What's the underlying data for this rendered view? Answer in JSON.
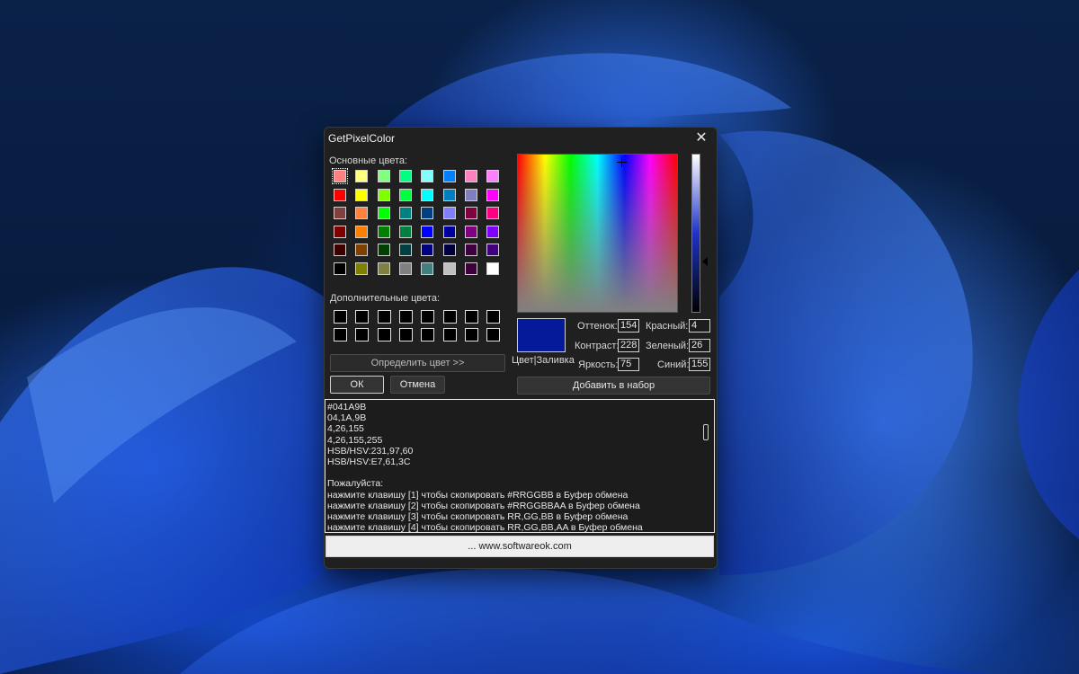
{
  "window": {
    "title": "GetPixelColor",
    "close_glyph": "✕"
  },
  "basic_colors": {
    "label": "Основные цвета:",
    "swatches": [
      "#ff8080",
      "#ffff80",
      "#80ff80",
      "#00ff80",
      "#80ffff",
      "#0080ff",
      "#ff80c0",
      "#ff80ff",
      "#ff0000",
      "#ffff00",
      "#80ff00",
      "#00ff40",
      "#00ffff",
      "#0080c0",
      "#8080c0",
      "#ff00ff",
      "#804040",
      "#ff8040",
      "#00ff00",
      "#008080",
      "#004080",
      "#8080ff",
      "#800040",
      "#ff0080",
      "#800000",
      "#ff8000",
      "#008000",
      "#008040",
      "#0000ff",
      "#0000a0",
      "#800080",
      "#8000ff",
      "#400000",
      "#804000",
      "#004000",
      "#004040",
      "#000080",
      "#000040",
      "#400040",
      "#400080",
      "#000000",
      "#808000",
      "#808040",
      "#808080",
      "#408080",
      "#c0c0c0",
      "#400040",
      "#ffffff"
    ]
  },
  "custom_colors": {
    "label": "Дополнительные цвета:",
    "count": 16,
    "color": "#000000"
  },
  "buttons": {
    "define": "Определить цвет >>",
    "ok": "ОК",
    "cancel": "Отмена",
    "add": "Добавить в набор"
  },
  "preview": {
    "color": "#041A9B",
    "label": "Цвет|Заливка"
  },
  "fields": {
    "hue_label": "Оттенок:",
    "hue": "154",
    "sat_label": "Контраст:",
    "sat": "228",
    "lum_label": "Яркость:",
    "lum": "75",
    "red_label": "Красный:",
    "red": "4",
    "green_label": "Зеленый:",
    "green": "26",
    "blue_label": "Синий:",
    "blue": "155"
  },
  "output_lines": [
    "#041A9B",
    "04,1A,9B",
    "4,26,155",
    "4,26,155,255",
    "HSB/HSV:231,97,60",
    "HSB/HSV:E7,61,3C",
    "",
    "Пожалуйста:",
    "нажмите клавишу [1] чтобы скопировать #RRGGBB в Буфер обмена",
    "нажмите клавишу [2] чтобы скопировать #RRGGBBAA в Буфер обмена",
    "нажмите клавишу [3] чтобы скопировать RR,GG,BB в Буфер обмена",
    "нажмите клавишу [4] чтобы скопировать RR,GG,BB,AA в Буфер обмена"
  ],
  "link": "... www.softwareok.com"
}
